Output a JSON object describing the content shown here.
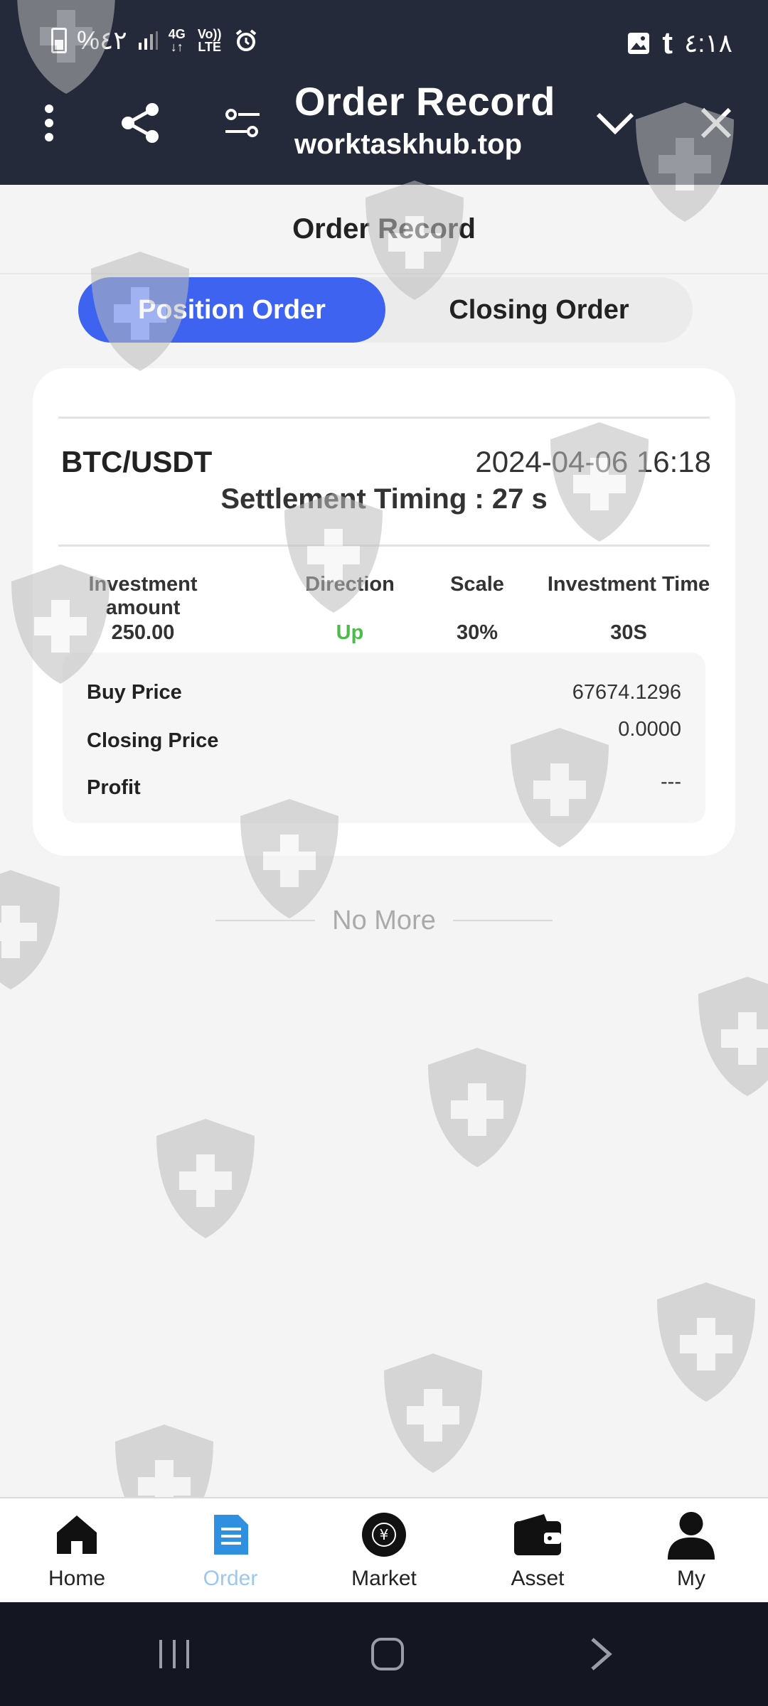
{
  "status": {
    "battery": "%٤٢",
    "network": "4G",
    "volte": "Vo)) LTE",
    "time": "٤:١٨"
  },
  "browser": {
    "title": "Order Record",
    "url": "worktaskhub.top"
  },
  "header": {
    "title": "Order Record"
  },
  "tabs": [
    {
      "label": "Position Order",
      "active": true
    },
    {
      "label": "Closing Order",
      "active": false
    }
  ],
  "order": {
    "pair": "BTC/USDT",
    "datetime": "2024-04-06 16:18",
    "settlement": "Settlement Timing : 27 s",
    "columns": [
      {
        "header": "Investment amount",
        "value": "250.00"
      },
      {
        "header": "Direction",
        "value": "Up"
      },
      {
        "header": "Scale",
        "value": "30%"
      },
      {
        "header": "Investment Time",
        "value": "30S"
      }
    ],
    "details": [
      {
        "label": "Buy Price",
        "value": "67674.1296"
      },
      {
        "label": "Closing Price",
        "value": "0.0000"
      },
      {
        "label": "Profit",
        "value": "---"
      }
    ],
    "direction_color": "#4cbb4c"
  },
  "list_end": "No More",
  "nav": [
    {
      "label": "Home",
      "icon": "home-icon"
    },
    {
      "label": "Order",
      "icon": "order-icon",
      "active": true
    },
    {
      "label": "Market",
      "icon": "market-icon"
    },
    {
      "label": "Asset",
      "icon": "wallet-icon"
    },
    {
      "label": "My",
      "icon": "user-icon"
    }
  ],
  "colors": {
    "topbar": "#252a3a",
    "accent": "#3d63f0",
    "nav_active": "#9cc8ef"
  }
}
